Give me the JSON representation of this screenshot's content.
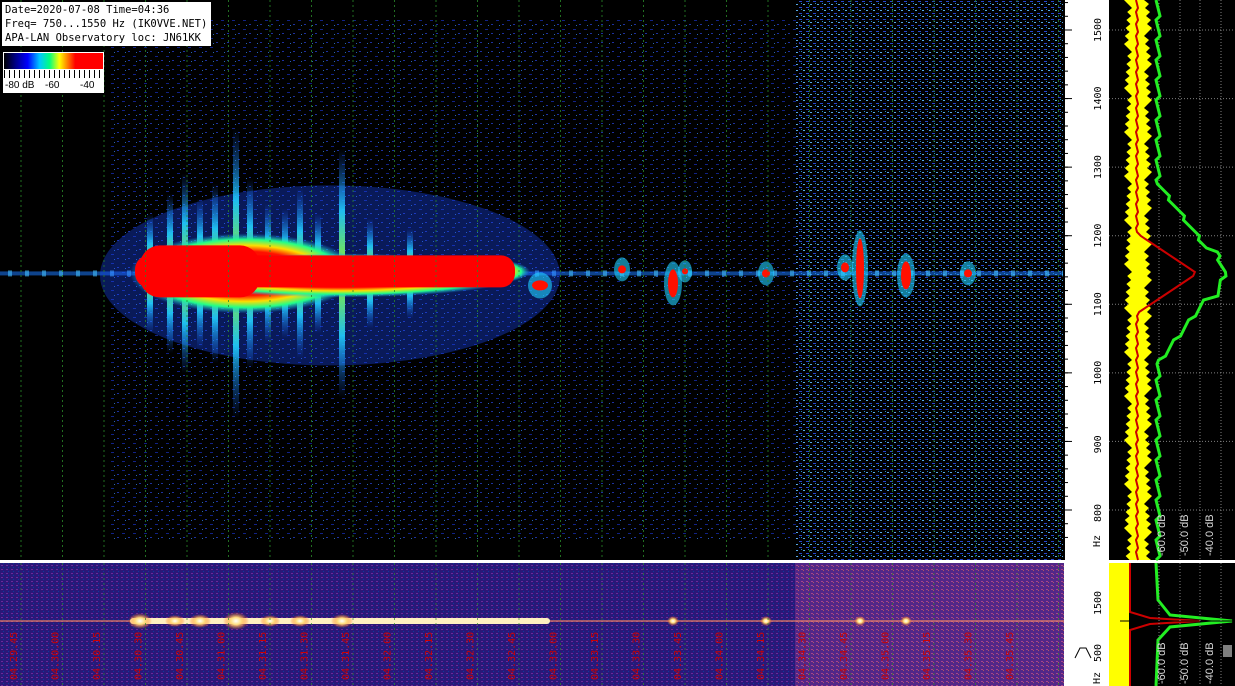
{
  "info": {
    "line1": "Date=2020-07-08 Time=04:36",
    "line2": "Freq= 750...1550 Hz (IK0VVE.NET)",
    "line3": "APA-LAN Observatory loc: JN61KK"
  },
  "colorbar": {
    "labels": [
      "-80 dB",
      "-60",
      "-40"
    ]
  },
  "chart_data": [
    {
      "type": "heatmap",
      "name": "spectrogram",
      "y_ticks": [
        800,
        900,
        1000,
        1100,
        1200,
        1300,
        1400,
        1500
      ],
      "y_unit": "Hz",
      "ylim": [
        750,
        1550
      ],
      "signal_center_hz": 1145,
      "event_start": "04:30:30",
      "event_end": "04:32:45",
      "colors": {
        "background": "#000000",
        "noise": "#1a2fcf",
        "mid": "#22e0ff",
        "peak": "#ff0000",
        "grid": "#2a8a2a"
      }
    },
    {
      "type": "heatmap",
      "name": "overview",
      "y_ticks": [
        500,
        1500
      ],
      "y_unit": "Hz",
      "x_ticks": [
        "04.29.45",
        "04.30.00",
        "04.30.15",
        "04.30.30",
        "04.30.45",
        "04.31.00",
        "04.31.15",
        "04.31.30",
        "04.31.45",
        "04.32.00",
        "04.32.15",
        "04.32.30",
        "04.32.45",
        "04.33.00",
        "04.33.15",
        "04.33.30",
        "04.33.45",
        "04.34.00",
        "04.34.15",
        "04.34.30",
        "04.34.45",
        "04.35.00",
        "04.35.15",
        "04.35.30",
        "04.35.45"
      ],
      "colors": {
        "background": "#1a0a55",
        "trace": "#ffffff",
        "label": "#cc0000"
      }
    },
    {
      "type": "line",
      "name": "spectrum",
      "x_ticks": [
        "-60.0 dB",
        "-50.0 dB",
        "-40.0 dB"
      ],
      "colors": {
        "band": "#ffff00",
        "avg": "#cc0000",
        "max": "#22ee22"
      }
    },
    {
      "type": "line",
      "name": "spectrum-small",
      "x_ticks": [
        "-60.0 dB",
        "-50.0 dB",
        "-40.0 dB"
      ]
    }
  ]
}
